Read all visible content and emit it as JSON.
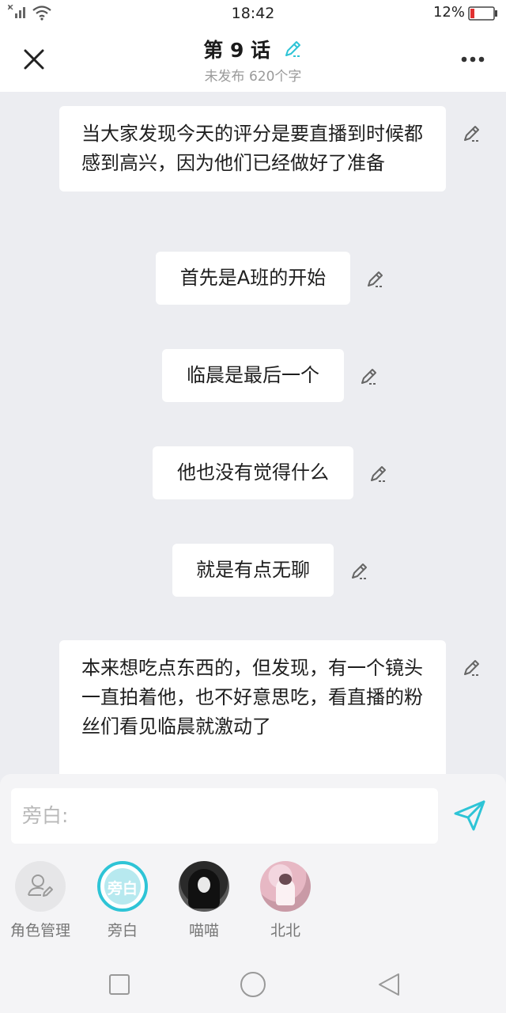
{
  "status": {
    "time": "18:42",
    "battery": "12%"
  },
  "header": {
    "title": "第 9 话",
    "subtitle": "未发布 620个字"
  },
  "messages": [
    "当大家发现今天的评分是要直播到时候都感到高兴，因为他们已经做好了准备",
    "首先是A班的开始",
    "临晨是最后一个",
    "他也没有觉得什么",
    "就是有点无聊",
    "本来想吃点东西的，但发现，有一个镜头一直拍着他，也不好意思吃，看直播的粉丝们看见临晨就激动了"
  ],
  "composer": {
    "placeholder": "旁白:"
  },
  "roles": [
    {
      "name": "角色管理",
      "icon": "person-edit-icon"
    },
    {
      "name": "旁白",
      "badge": "旁白",
      "selected": true
    },
    {
      "name": "喵喵",
      "icon": "avatar-photo"
    },
    {
      "name": "北北",
      "icon": "avatar-photo"
    }
  ],
  "colors": {
    "accent": "#2ec4d6",
    "background": "#ecedf1",
    "bubble": "#ffffff"
  }
}
